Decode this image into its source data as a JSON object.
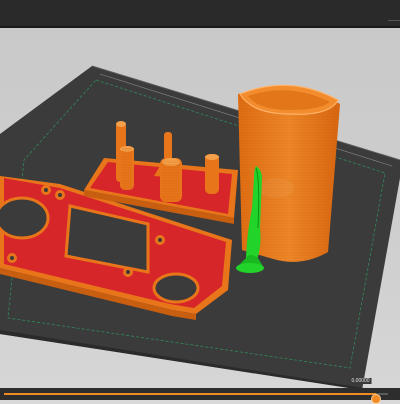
{
  "window": {
    "title": ""
  },
  "viewport": {
    "bed_color": "#3b3b3b",
    "objects": [
      {
        "name": "gasket-plate",
        "color": "#e8751a",
        "accent": "#d7262a"
      },
      {
        "name": "pegs-base",
        "color": "#e8751a",
        "accent": "#d7262a"
      },
      {
        "name": "cup",
        "color": "#e8751a"
      },
      {
        "name": "horn",
        "color": "#22d42a"
      }
    ]
  },
  "layer_slider": {
    "label": "0.00000",
    "value_fraction": 0.97,
    "accent": "#f08a24"
  }
}
